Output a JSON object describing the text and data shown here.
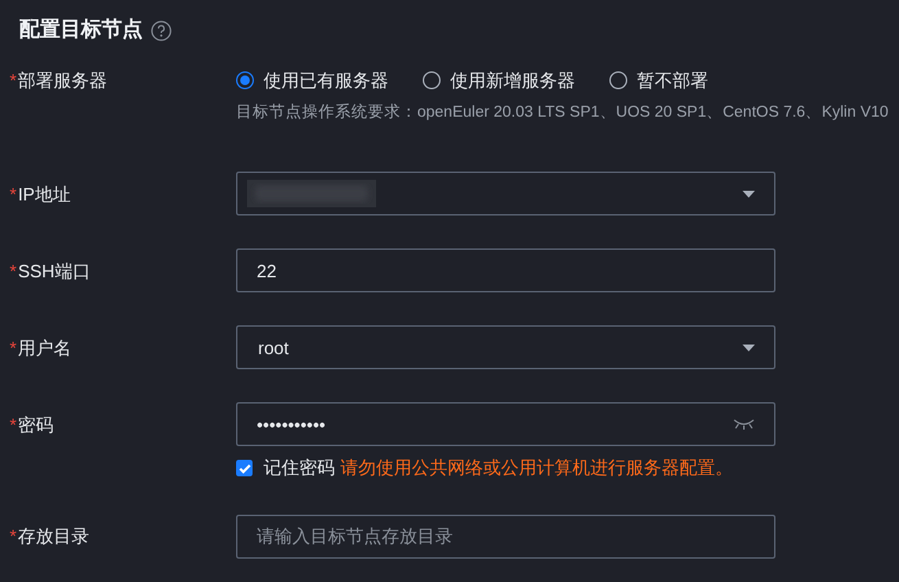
{
  "section": {
    "title": "配置目标节点",
    "help_icon": true
  },
  "deploy": {
    "label": "部署服务器",
    "required_mark": "*",
    "options": [
      {
        "label": "使用已有服务器",
        "selected": true
      },
      {
        "label": "使用新增服务器",
        "selected": false
      },
      {
        "label": "暂不部署",
        "selected": false
      }
    ],
    "hint": "目标节点操作系统要求：openEuler 20.03 LTS SP1、UOS 20 SP1、CentOS 7.6、Kylin V10"
  },
  "fields": [
    {
      "kind": "select",
      "label": "IP地址",
      "required_mark": "*",
      "value_hidden": true
    },
    {
      "kind": "text",
      "label": "SSH端口",
      "required_mark": "*",
      "value": "22"
    },
    {
      "kind": "select",
      "label": "用户名",
      "required_mark": "*",
      "value": "root"
    },
    {
      "kind": "password",
      "label": "密码",
      "required_mark": "*",
      "value": "•••••••••••",
      "remember": {
        "label": "记住密码",
        "checked": true,
        "warning": "请勿使用公共网络或公用计算机进行服务器配置。"
      }
    },
    {
      "kind": "text",
      "label": "存放目录",
      "required_mark": "*",
      "placeholder": "请输入目标节点存放目录"
    }
  ]
}
